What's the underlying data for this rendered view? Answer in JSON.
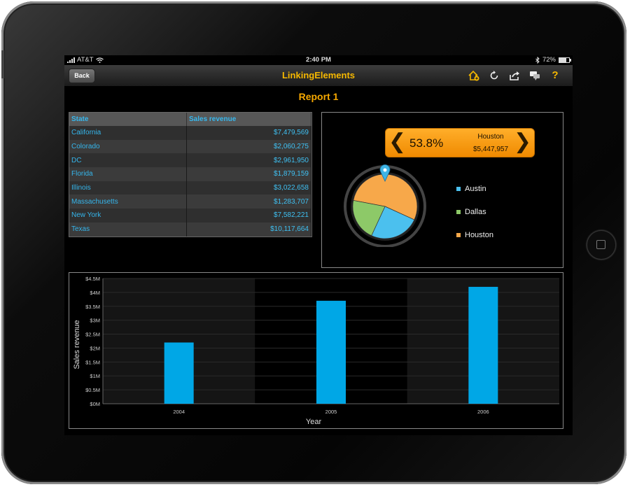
{
  "status": {
    "carrier": "AT&T",
    "time": "2:40 PM",
    "battery": "72%",
    "battery_level": 0.72
  },
  "navbar": {
    "back_label": "Back",
    "title": "LinkingElements",
    "icons": [
      "home-add-icon",
      "refresh-icon",
      "share-icon",
      "comments-icon",
      "help-icon"
    ],
    "help_glyph": "?"
  },
  "report": {
    "title": "Report 1"
  },
  "grid": {
    "headers": [
      "State",
      "Sales revenue"
    ],
    "rows": [
      [
        "California",
        "$7,479,569"
      ],
      [
        "Colorado",
        "$2,060,275"
      ],
      [
        "DC",
        "$2,961,950"
      ],
      [
        "Florida",
        "$1,879,159"
      ],
      [
        "Illinois",
        "$3,022,658"
      ],
      [
        "Massachusetts",
        "$1,283,707"
      ],
      [
        "New York",
        "$7,582,221"
      ],
      [
        "Texas",
        "$10,117,664"
      ]
    ]
  },
  "pie": {
    "selector": {
      "percent": "53.8%",
      "name": "Houston",
      "value": "$5,447,957",
      "prev_glyph": "❮",
      "next_glyph": "❯"
    }
  },
  "colors": {
    "accent": "#f6a800",
    "bar": "#00a7e6",
    "austin": "#4bc0ee",
    "dallas": "#8dc968",
    "houston": "#f7a84a"
  },
  "chart_data": [
    {
      "type": "pie",
      "categories": [
        "Austin",
        "Dallas",
        "Houston"
      ],
      "values": [
        25.1,
        21.1,
        53.8
      ],
      "colors": [
        "#4bc0ee",
        "#8dc968",
        "#f7a84a"
      ],
      "selected": "Houston",
      "legend": "right"
    },
    {
      "type": "bar",
      "categories": [
        "2004",
        "2005",
        "2006"
      ],
      "values": [
        2.2,
        3.7,
        4.2
      ],
      "xlabel": "Year",
      "ylabel": "Sales revenue",
      "ylim": [
        0,
        4.5
      ],
      "yticks": [
        0,
        0.5,
        1,
        1.5,
        2,
        2.5,
        3,
        3.5,
        4,
        4.5
      ],
      "ytick_labels": [
        "$0M",
        "$0.5M",
        "$1M",
        "$1.5M",
        "$2M",
        "$2.5M",
        "$3M",
        "$3.5M",
        "$4M",
        "$4.5M"
      ],
      "grid": true
    }
  ]
}
